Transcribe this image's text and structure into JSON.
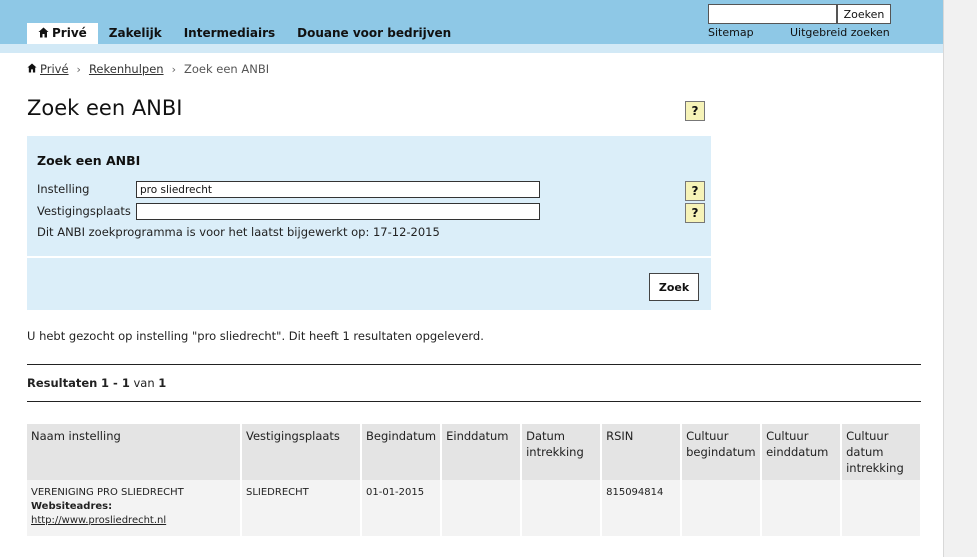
{
  "header": {
    "nav": [
      {
        "label": "Privé",
        "active": true,
        "icon": "home-icon"
      },
      {
        "label": "Zakelijk"
      },
      {
        "label": "Intermediairs"
      },
      {
        "label": "Douane voor bedrijven"
      }
    ],
    "search": {
      "value": "",
      "button_label": "Zoeken"
    },
    "links": {
      "sitemap": "Sitemap",
      "advanced_search": "Uitgebreid zoeken"
    },
    "colors": {
      "topbar": "#8ec8e6",
      "subbar": "#d2e9f6"
    }
  },
  "breadcrumb": {
    "home": "Privé",
    "rekenhulpen": "Rekenhulpen",
    "current": "Zoek een ANBI",
    "separator": "›"
  },
  "page": {
    "title": "Zoek een ANBI",
    "help_label": "?"
  },
  "form": {
    "heading": "Zoek een ANBI",
    "instelling_label": "Instelling",
    "instelling_value": "pro sliedrecht",
    "vestigingsplaats_label": "Vestigingsplaats",
    "vestigingsplaats_value": "",
    "note": "Dit ANBI zoekprogramma is voor het laatst bijgewerkt op: 17-12-2015",
    "submit_label": "Zoek",
    "panel_color": "#dbeef9",
    "help_color": "#f6f3b8"
  },
  "summary": "U hebt gezocht op instelling \"pro sliedrecht\". Dit heeft 1 resultaten opgeleverd.",
  "results": {
    "prefix": "Resultaten",
    "range": "1 - 1",
    "of": "van",
    "total": "1",
    "columns": [
      "Naam instelling",
      "Vestigingsplaats",
      "Begindatum",
      "Einddatum",
      "Datum intrekking",
      "RSIN",
      "Cultuur begindatum",
      "Cultuur einddatum",
      "Cultuur datum intrekking"
    ],
    "rows": [
      {
        "naam": "VERENIGING PRO SLIEDRECHT",
        "website_label": "Websiteadres:",
        "website": "http://www.prosliedrecht.nl",
        "vestigingsplaats": "SLIEDRECHT",
        "begindatum": "01-01-2015",
        "einddatum": "",
        "datum_intrekking": "",
        "rsin": "815094814",
        "cultuur_begindatum": "",
        "cultuur_einddatum": "",
        "cultuur_datum_intrekking": ""
      }
    ]
  }
}
